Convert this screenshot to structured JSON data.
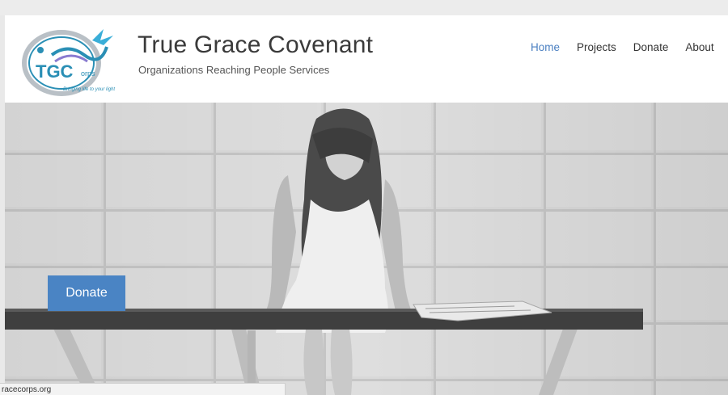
{
  "site": {
    "logo_text": "TGC",
    "logo_suffix": "orps",
    "logo_slogan": "Bringing life to your light",
    "title": "True Grace Covenant",
    "tagline": "Organizations Reaching People Services"
  },
  "nav": {
    "items": [
      {
        "label": "Home",
        "active": true
      },
      {
        "label": "Projects",
        "active": false
      },
      {
        "label": "Donate",
        "active": false
      },
      {
        "label": "About",
        "active": false
      }
    ]
  },
  "hero": {
    "image": "grayscale photo of a woman sitting on a bench against a tiled wall",
    "cta_label": "Donate"
  },
  "status_bar": {
    "url": "racecorps.org"
  },
  "colors": {
    "accent": "#4a84c4",
    "nav_active": "#4a7fc1",
    "title": "#3a3a3a",
    "logo_blue": "#2a8fb5"
  }
}
